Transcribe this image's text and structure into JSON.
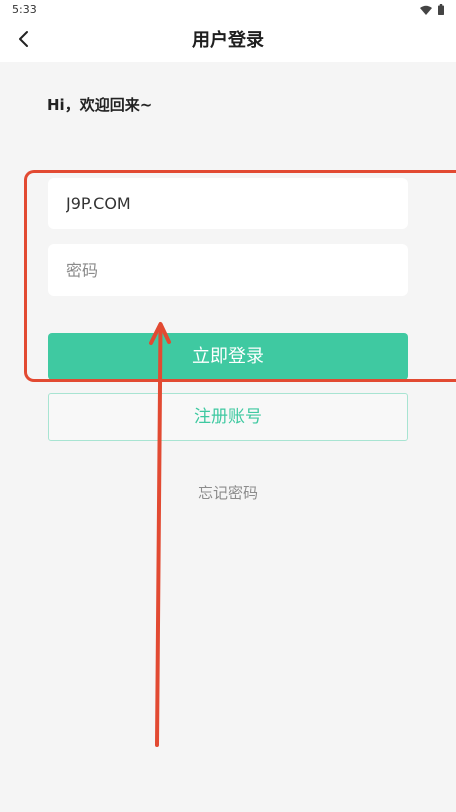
{
  "status_bar": {
    "time": "5:33",
    "icons": [
      "wifi-icon",
      "battery-icon"
    ]
  },
  "header": {
    "title": "用户登录",
    "back_icon": "chevron-left-icon"
  },
  "greeting": "Hi，欢迎回来~",
  "form": {
    "username": {
      "value": "J9P.COM"
    },
    "password": {
      "placeholder": "密码"
    }
  },
  "buttons": {
    "login": "立即登录",
    "register": "注册账号",
    "forgot_password": "忘记密码"
  },
  "colors": {
    "accent": "#3fc9a1",
    "annotation": "#e24a32",
    "background": "#f5f5f5"
  }
}
